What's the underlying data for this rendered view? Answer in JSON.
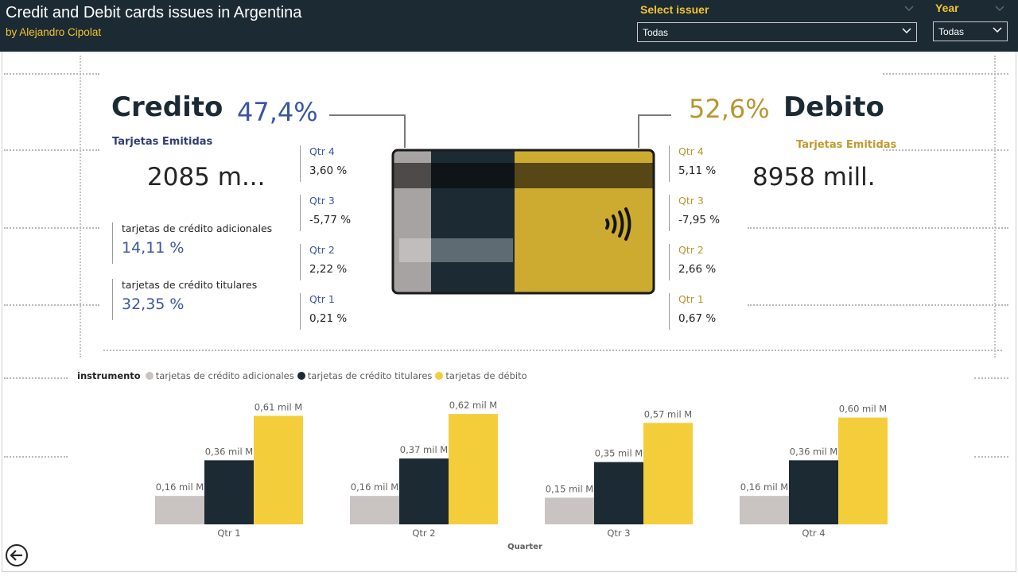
{
  "header": {
    "title": "Credit and Debit cards issues in Argentina",
    "subtitle": "by Alejandro Cipolat"
  },
  "slicers": {
    "issuer": {
      "label": "Select issuer",
      "value": "Todas"
    },
    "year": {
      "label": "Year",
      "value": "Todas"
    }
  },
  "credit": {
    "label": "Credito",
    "share": "47,4%",
    "issued_label": "Tarjetas Emitidas",
    "issued_value": "2085 m...",
    "additional_label": "tarjetas de crédito adicionales",
    "additional_value": "14,11 %",
    "holders_label": "tarjetas de crédito titulares",
    "holders_value": "32,35 %",
    "quarters": [
      {
        "q": "Qtr 4",
        "v": "3,60 %"
      },
      {
        "q": "Qtr 3",
        "v": "-5,77 %"
      },
      {
        "q": "Qtr 2",
        "v": "2,22 %"
      },
      {
        "q": "Qtr 1",
        "v": "0,21 %"
      }
    ]
  },
  "debit": {
    "label": "Debito",
    "share": "52,6%",
    "issued_label": "Tarjetas Emitidas",
    "issued_value": "8958 mill.",
    "quarters": [
      {
        "q": "Qtr 4",
        "v": "5,11 %"
      },
      {
        "q": "Qtr 3",
        "v": "-7,95 %"
      },
      {
        "q": "Qtr 2",
        "v": "2,66 %"
      },
      {
        "q": "Qtr 1",
        "v": "0,67 %"
      }
    ]
  },
  "colors": {
    "credit_blue": "#3a56a0",
    "debit_gold": "#b8962e",
    "navy": "#1c2a33",
    "yellow": "#f4cd3a",
    "grey": "#c9c4c2"
  },
  "icons": {
    "contactless": "contactless-icon",
    "back": "back-arrow-icon"
  },
  "chart_data": {
    "type": "bar",
    "legend_title": "instrumento",
    "categories": [
      "Qtr 1",
      "Qtr 2",
      "Qtr 3",
      "Qtr 4"
    ],
    "xlabel": "Quarter",
    "series": [
      {
        "name": "tarjetas de crédito adicionales",
        "color": "#c9c4c2",
        "values": [
          0.16,
          0.16,
          0.15,
          0.16
        ],
        "labels": [
          "0,16 mil M",
          "0,16 mil M",
          "0,15 mil M",
          "0,16 mil M"
        ]
      },
      {
        "name": "tarjetas de crédito titulares",
        "color": "#1c2a33",
        "values": [
          0.36,
          0.37,
          0.35,
          0.36
        ],
        "labels": [
          "0,36 mil M",
          "0,37 mil M",
          "0,35 mil M",
          "0,36 mil M"
        ]
      },
      {
        "name": "tarjetas de débito",
        "color": "#f4cd3a",
        "values": [
          0.61,
          0.62,
          0.57,
          0.6
        ],
        "labels": [
          "0,61 mil M",
          "0,62 mil M",
          "0,57 mil M",
          "0,60 mil M"
        ]
      }
    ],
    "legend_position": "top-left"
  }
}
